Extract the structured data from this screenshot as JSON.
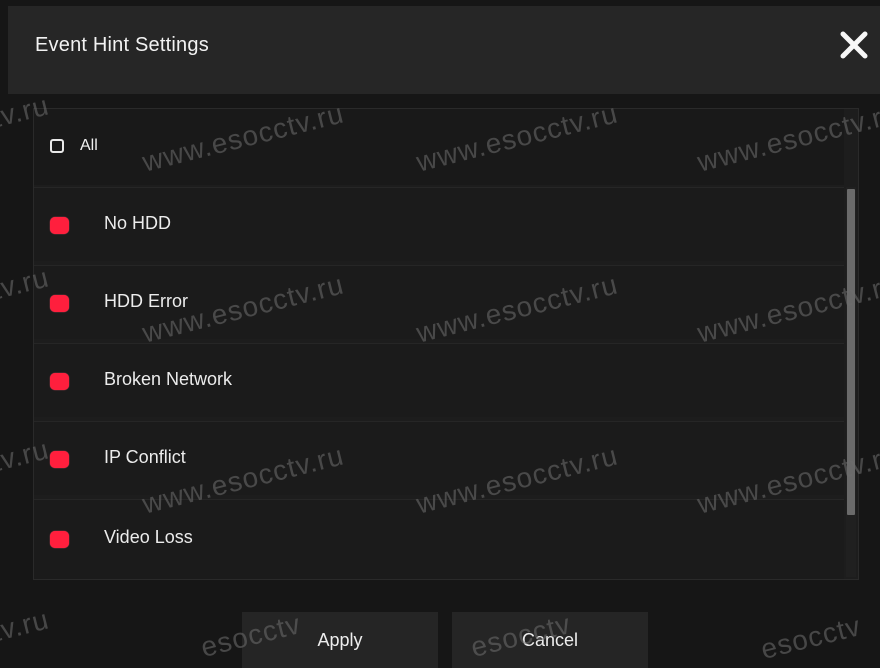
{
  "dialog": {
    "title": "Event Hint Settings",
    "close_icon": "close-icon"
  },
  "header": {
    "all_label": "All",
    "all_checked": false
  },
  "events": [
    {
      "label": "No HDD",
      "indicator_color": "#ff1f3d"
    },
    {
      "label": "HDD Error",
      "indicator_color": "#ff1f3d"
    },
    {
      "label": "Broken Network",
      "indicator_color": "#ff1f3d"
    },
    {
      "label": "IP Conflict",
      "indicator_color": "#ff1f3d"
    },
    {
      "label": "Video Loss",
      "indicator_color": "#ff1f3d"
    }
  ],
  "buttons": {
    "apply": "Apply",
    "cancel": "Cancel"
  },
  "watermark": {
    "full": "www.esocctv.ru",
    "fragment": "tv.ru",
    "short": "esocctv"
  },
  "colors": {
    "accent": "#ff1f3d",
    "background": "#161616",
    "text": "#ececec"
  }
}
